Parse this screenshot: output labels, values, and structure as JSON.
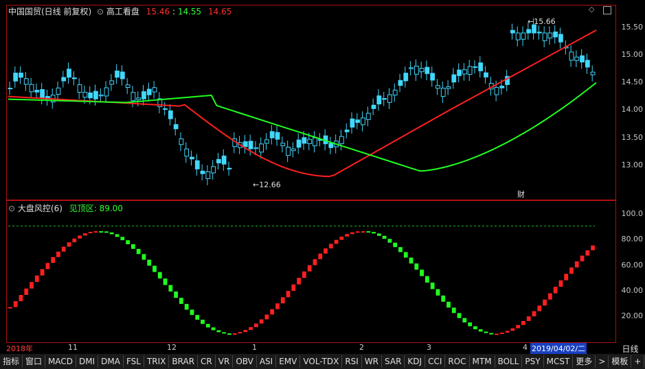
{
  "header": {
    "stock_name": "中国国贸(日线 前复权)",
    "indicator_name": "高工看盘",
    "val1": "15.46",
    "val2": "14.55",
    "val3": "14.65",
    "colors": {
      "red": "#ff3030",
      "green": "#30ff30",
      "cyan": "#40d8ff"
    }
  },
  "price_axis": [
    "15.50",
    "15.00",
    "14.50",
    "14.00",
    "13.50",
    "13.00"
  ],
  "price_annotations": {
    "high": "15.66",
    "low": "12.66",
    "marker": "财"
  },
  "lower_header": {
    "name": "大盘风控(6)",
    "param_label": "见顶区: 89.00"
  },
  "lower_axis": [
    "100.0",
    "80.00",
    "60.00",
    "40.00",
    "20.00"
  ],
  "date_bar": {
    "labels": [
      "2018年",
      "11",
      "12",
      "1",
      "2",
      "3",
      "4"
    ],
    "current": "2019/04/02/二",
    "period": "日线"
  },
  "toolbar": [
    "指标",
    "窗口",
    "MACD",
    "DMI",
    "DMA",
    "FSL",
    "TRIX",
    "BRAR",
    "CR",
    "VR",
    "OBV",
    "ASI",
    "EMV",
    "VOL-TDX",
    "RSI",
    "WR",
    "SAR",
    "KDJ",
    "CCI",
    "ROC",
    "MTM",
    "BOLL",
    "PSY",
    "MCST",
    "更多",
    ">",
    "模板",
    "+"
  ],
  "chart_data": {
    "type": "candlestick",
    "title": "中国国贸(日线 前复权)",
    "ylim": [
      12.5,
      15.8
    ],
    "high": 15.66,
    "low": 12.66,
    "lower_indicator": {
      "name": "大盘风控(6)",
      "threshold": 89.0,
      "ylim": [
        0,
        100
      ]
    }
  }
}
